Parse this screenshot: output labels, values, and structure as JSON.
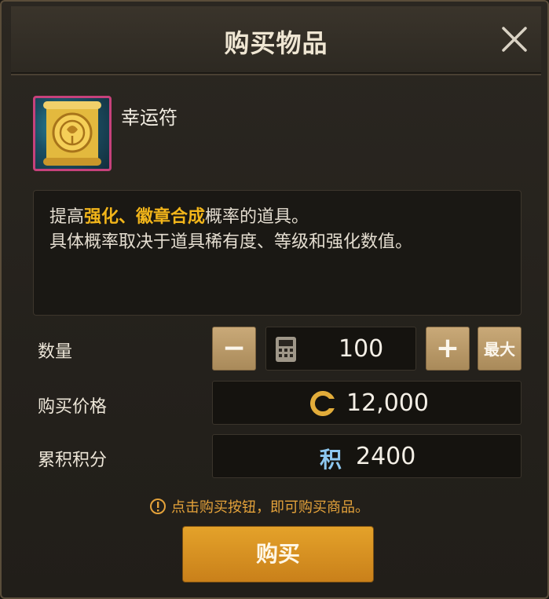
{
  "dialog": {
    "title": "购买物品",
    "close_icon": "close-icon"
  },
  "item": {
    "name": "幸运符",
    "icon": "lucky-charm-scroll-icon",
    "rarity_border_color": "#c6417b"
  },
  "description": {
    "line1_prefix": "提高",
    "line1_highlight": "强化、徽章合成",
    "line1_suffix": "概率的道具。",
    "line2": "具体概率取决于道具稀有度、等级和强化数值。",
    "highlight_color": "#f2b51a"
  },
  "quantity": {
    "label": "数量",
    "minus_label": "−",
    "plus_label": "+",
    "max_label": "最大",
    "value": "100",
    "calculator_icon": "calculator-icon"
  },
  "price": {
    "label": "购买价格",
    "currency_icon": "gold-coin-icon",
    "value": "12,000"
  },
  "points": {
    "label": "累积积分",
    "icon_text": "积",
    "value": "2400"
  },
  "notice": {
    "icon": "exclamation-circle-icon",
    "text": "点击购买按钮，即可购买商品。"
  },
  "buy_button": {
    "label": "购买",
    "color": "#d9901f"
  }
}
